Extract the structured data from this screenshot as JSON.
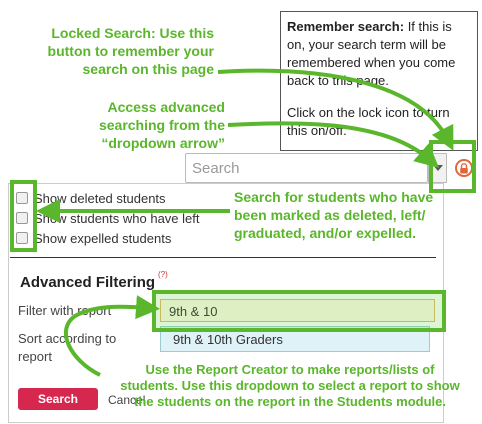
{
  "tooltip": {
    "title": "Remember search:",
    "body": "If this is on, your search term will be remembered when you come back to this page.",
    "body2": "Click on the lock icon to turn this on/off."
  },
  "search": {
    "placeholder": "Search"
  },
  "filters": {
    "deleted": "Show deleted students",
    "left": "Show students who have left",
    "expelled": "Show expelled students"
  },
  "advanced": {
    "title": "Advanced Filtering",
    "help": "(?)",
    "filter_label": "Filter with report",
    "sort_label_1": "Sort according to",
    "sort_label_2": "report",
    "report_value": "9th & 10",
    "report_option": "9th & 10th Graders",
    "search_button": "Search",
    "cancel": "Cancel"
  },
  "annotations": {
    "locked": [
      "Locked Search: Use this",
      "button to remember your",
      "search on this page"
    ],
    "advanced": [
      "Access advanced",
      "searching from the",
      "“dropdown arrow”"
    ],
    "students": [
      "Search for students who have",
      "been marked as deleted, left/",
      "graduated, and/or expelled."
    ],
    "report": [
      "Use the Report Creator to make reports/lists of",
      "students. Use this dropdown to select a report to show",
      "the students on the report in the Students module."
    ]
  },
  "colors": {
    "annotation": "#5ab62b",
    "search_button": "#d6274f",
    "lock": "#e0673c"
  }
}
